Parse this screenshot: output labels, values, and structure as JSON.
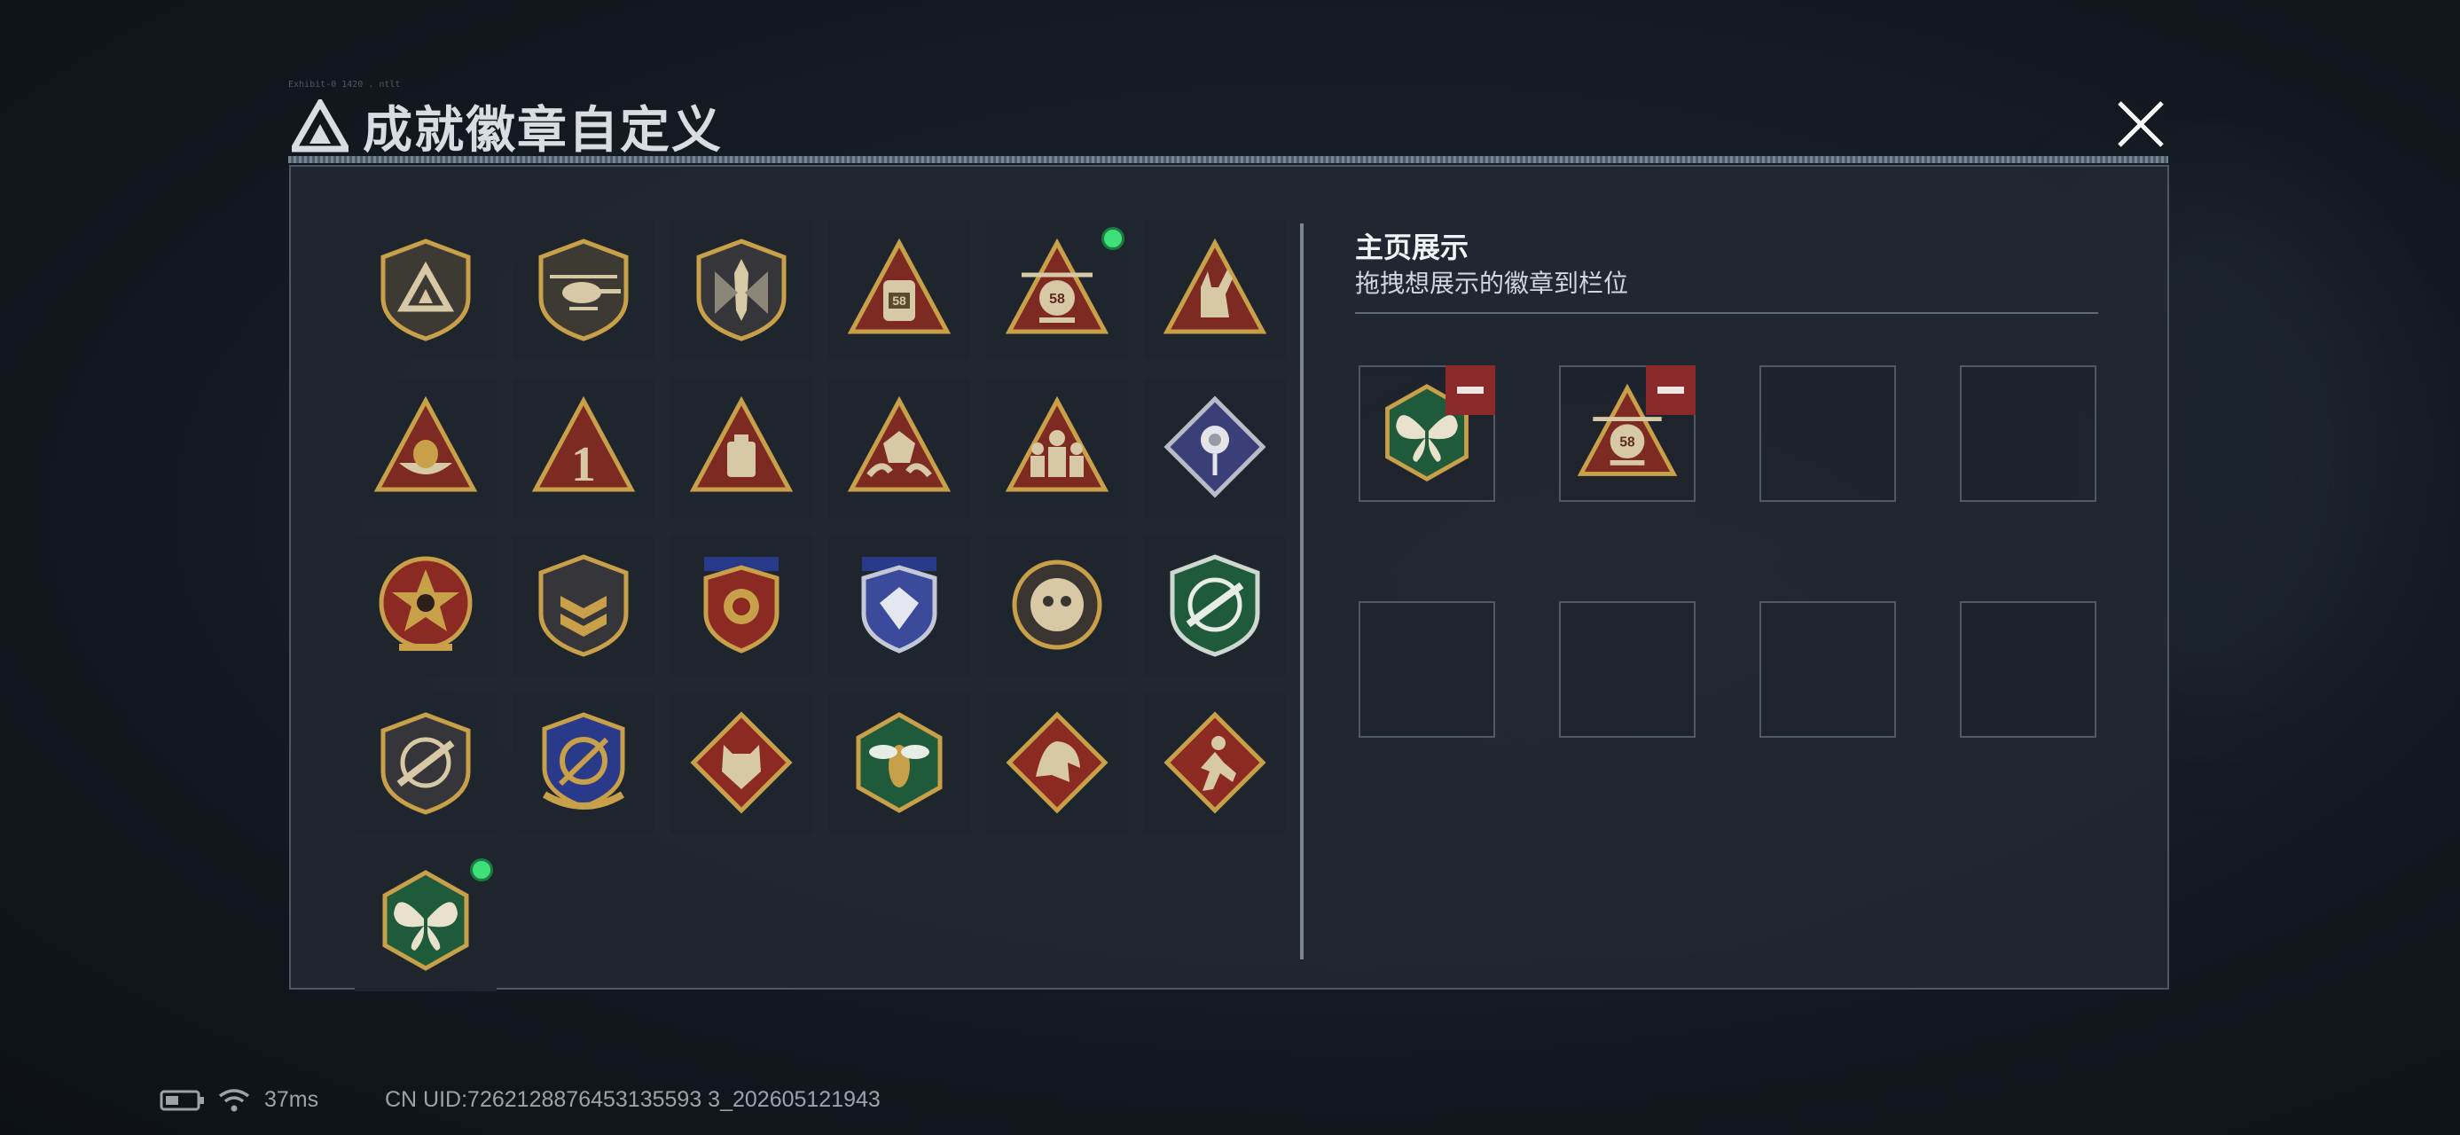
{
  "header": {
    "title": "成就徽章自定义",
    "micro_label": "Exhibit-0 1420 . ntlt"
  },
  "icons": {
    "logo": "triangle-logo-icon",
    "close": "close-icon"
  },
  "badges": [
    {
      "name": "triangle-shield-badge",
      "selected": false
    },
    {
      "name": "helicopter-shield-badge",
      "selected": false
    },
    {
      "name": "dagger-shield-badge",
      "selected": false
    },
    {
      "name": "backpack-58-badge",
      "selected": false,
      "label": "58"
    },
    {
      "name": "helicopter-58-badge",
      "selected": true,
      "label": "58"
    },
    {
      "name": "hand-gesture-badge",
      "selected": false
    },
    {
      "name": "nest-egg-badge",
      "selected": false
    },
    {
      "name": "number-one-badge",
      "selected": false,
      "label": "1"
    },
    {
      "name": "gold-bar-badge",
      "selected": false
    },
    {
      "name": "dice-hands-badge",
      "selected": false
    },
    {
      "name": "squad-badge",
      "selected": false
    },
    {
      "name": "rose-diamond-badge",
      "selected": false
    },
    {
      "name": "skull-star-badge",
      "selected": false
    },
    {
      "name": "chevron-shield-badge",
      "selected": false
    },
    {
      "name": "gold-ribbon-badge",
      "selected": false
    },
    {
      "name": "blue-diamond-badge",
      "selected": false
    },
    {
      "name": "round-beast-badge",
      "selected": false
    },
    {
      "name": "green-rifle-badge",
      "selected": false
    },
    {
      "name": "crosshair-rifle-badge",
      "selected": false
    },
    {
      "name": "crossed-arrows-badge",
      "selected": false
    },
    {
      "name": "wolf-diamond-badge",
      "selected": false
    },
    {
      "name": "hornet-hexagon-badge",
      "selected": false
    },
    {
      "name": "dragon-diamond-badge",
      "selected": false
    },
    {
      "name": "runner-diamond-badge",
      "selected": false
    },
    {
      "name": "butterfly-hexagon-badge",
      "selected": true
    }
  ],
  "showcase": {
    "title": "主页展示",
    "subtitle": "拖拽想展示的徽章到栏位",
    "slots": [
      {
        "badge": "butterfly-hexagon-badge"
      },
      {
        "badge": "helicopter-58-badge",
        "label": "58"
      },
      {
        "badge": null
      },
      {
        "badge": null
      },
      {
        "badge": null
      },
      {
        "badge": null
      },
      {
        "badge": null
      },
      {
        "badge": null
      }
    ]
  },
  "status_bar": {
    "battery_icon": "battery-icon",
    "wifi_icon": "wifi-icon",
    "ping": "37ms",
    "uid": "CN UID:7262128876453135593 3_202605121943"
  },
  "colors": {
    "gold": "#c9a04a",
    "dark_red": "#7c2a22",
    "green_dot": "#3ee07a",
    "minus_red": "#8a2a2a",
    "panel": "#212831"
  }
}
